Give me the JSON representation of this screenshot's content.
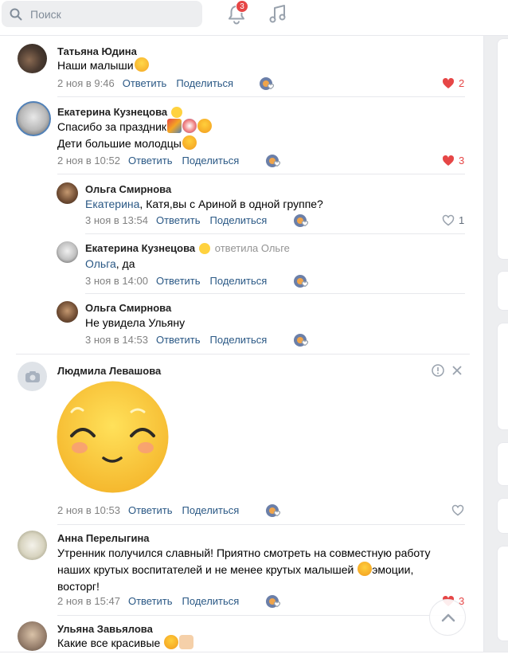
{
  "header": {
    "search_placeholder": "Поиск",
    "notifications_count": "3"
  },
  "actions": {
    "reply": "Ответить",
    "share": "Поделиться"
  },
  "comments": [
    {
      "name": "Татьяна Юдина",
      "text": "Наши малыши",
      "date": "2 ноя в 9:46",
      "likes": "2",
      "liked": true
    },
    {
      "name": "Екатерина Кузнецова",
      "text_1": "Спасибо за праздник",
      "text_2": "Дети большие молодцы",
      "date": "2 ноя в 10:52",
      "likes": "3",
      "liked": true
    },
    {
      "name": "Ольга Смирнова",
      "reply_to": "Екатерина",
      "text": ", Катя,вы с Ариной в одной группе?",
      "date": "3 ноя в 13:54",
      "likes": "1",
      "liked": false
    },
    {
      "name": "Екатерина Кузнецова",
      "replied": "ответила Ольге",
      "reply_to": "Ольга",
      "text": ", да",
      "date": "3 ноя в 14:00"
    },
    {
      "name": "Ольга Смирнова",
      "text": "Не увидела Ульяну",
      "date": "3 ноя в 14:53"
    },
    {
      "name": "Людмила Левашова",
      "date": "2 ноя в 10:53"
    },
    {
      "name": "Анна Перелыгина",
      "text_1": "Утренник получился славный! Приятно смотреть на совместную работу",
      "text_2": "наших крутых воспитателей и не менее крутых малышей",
      "text_2b": "эмоции,",
      "text_3": "восторг!",
      "date": "2 ноя в 15:47",
      "likes": "3",
      "liked": true
    },
    {
      "name": "Ульяна Завьялова",
      "text": "Какие все красивые"
    }
  ],
  "colors": {
    "link": "#2a5885",
    "like_red": "#e64646",
    "muted": "#828282"
  }
}
